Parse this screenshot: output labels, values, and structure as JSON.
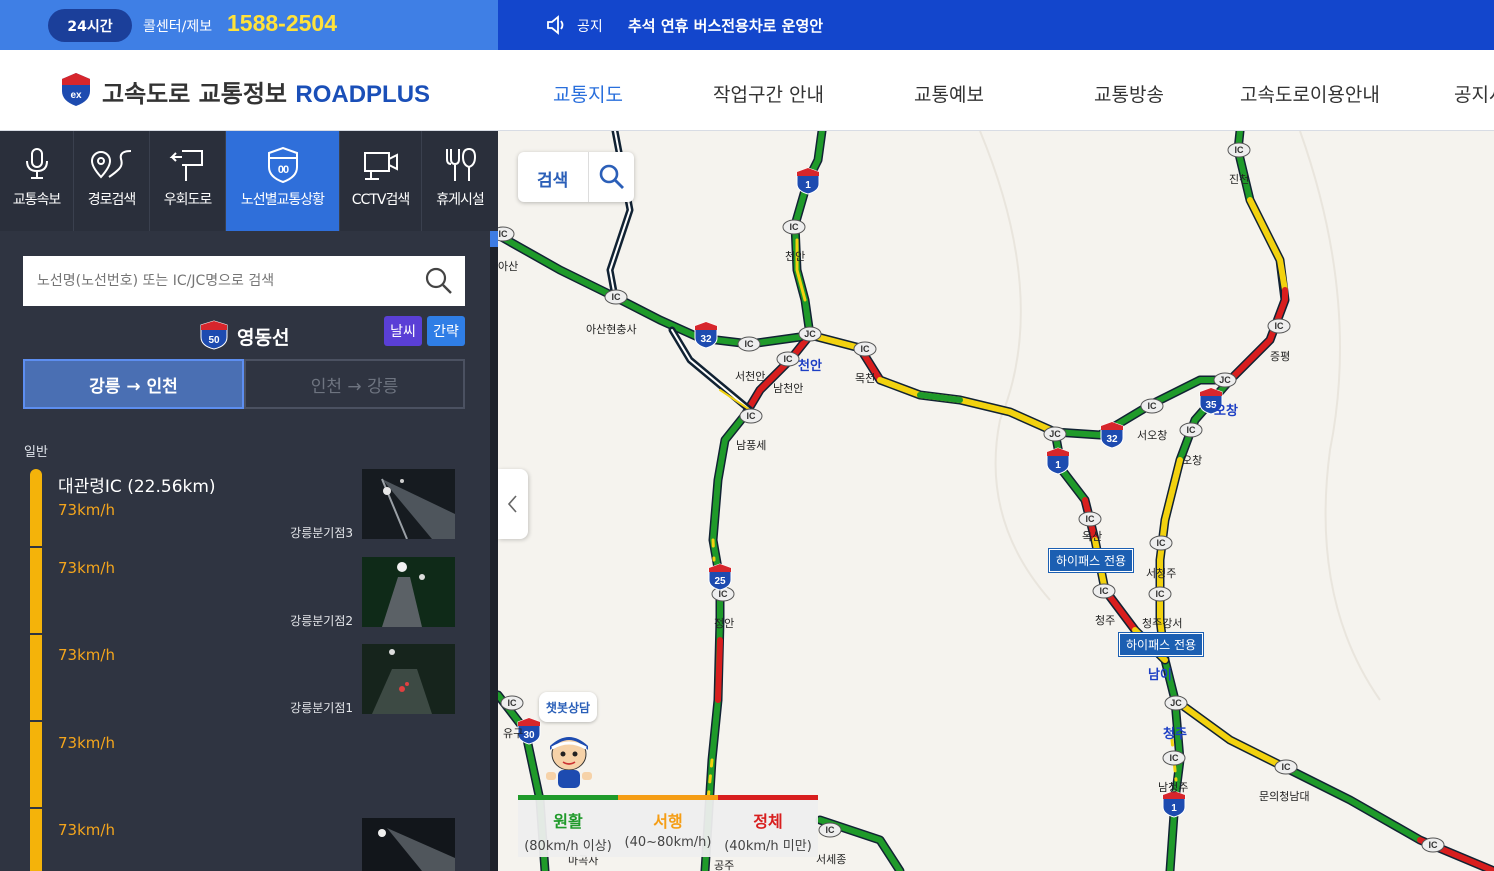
{
  "topbar": {
    "badge_24": "24시간",
    "callcenter_label": "콜센터/제보",
    "phone": "1588-2504",
    "notice_label": "공지",
    "notice_text": "추석 연휴 버스전용차로 운영안"
  },
  "header": {
    "logo_text": "고속도로 교통정보",
    "logo_brand": "ROADPLUS",
    "nav": [
      "교통지도",
      "작업구간 안내",
      "교통예보",
      "교통방송",
      "고속도로이용안내",
      "공지사"
    ]
  },
  "sidebar": {
    "tabs": [
      "교통속보",
      "경로검색",
      "우회도로",
      "노선별교통상황",
      "CCTV검색",
      "휴게시설"
    ],
    "active_tab": "노선별교통상황",
    "search_placeholder": "노선명(노선번호) 또는 IC/JC명으로 검색",
    "route_number": "50",
    "route_name": "영동선",
    "weather_button": "날씨",
    "simple_button": "간략",
    "direction_active": "강릉 → 인천",
    "direction_inactive": "인천 → 강릉",
    "section_label": "일반",
    "segments": [
      {
        "name": "대관령IC (22.56km)",
        "speed": "73km/h",
        "cctv": "강릉분기점3"
      },
      {
        "name": "",
        "speed": "73km/h",
        "cctv": "강릉분기점2"
      },
      {
        "name": "",
        "speed": "73km/h",
        "cctv": "강릉분기점1"
      },
      {
        "name": "",
        "speed": "73km/h",
        "cctv": ""
      },
      {
        "name": "",
        "speed": "73km/h",
        "cctv": ""
      }
    ]
  },
  "map": {
    "search_label": "검색",
    "chatbot_label": "챗봇상담",
    "legend": [
      {
        "title": "원활",
        "sub": "(80km/h 이상)",
        "color": "#1f9a2a"
      },
      {
        "title": "서행",
        "sub": "(40~80km/h)",
        "color": "#f59d14"
      },
      {
        "title": "정체",
        "sub": "(40km/h 미만)",
        "color": "#d81e1e"
      }
    ],
    "labels": {
      "asan": "아산",
      "asan_hyunchung": "아산현충사",
      "seocheonan": "서천안",
      "namcheonan": "남천안",
      "nampungse": "남풍세",
      "cheonan_ic": "천안",
      "cheonan_jc": "천안",
      "mokcheon": "목천",
      "seoochang": "서오창",
      "ochang": "오창",
      "ochang_jc": "오창",
      "jeungpyeong": "증평",
      "jincheon": "진천",
      "oksan": "옥산",
      "seocheongju": "서청주",
      "cheongju": "청주",
      "cheongju_gangseo": "청주강서",
      "nami": "남이",
      "cheongju_jc": "청주",
      "namcheongju": "남청주",
      "munui": "문의청남대",
      "jeongan": "정안",
      "gongju": "공주",
      "sejong": "서세종",
      "magoksa": "마곡사",
      "yugu": "유구",
      "hipass1": "하이패스 전용",
      "hipass2": "하이패스 전용",
      "ic": "IC",
      "jc": "JC"
    },
    "shields": [
      "1",
      "32",
      "32",
      "1",
      "35",
      "25",
      "30",
      "1"
    ]
  },
  "colors": {
    "green": "#1f9a2a",
    "yellow": "#f2d20f",
    "red": "#d81e1e",
    "primary": "#2f6fda"
  }
}
